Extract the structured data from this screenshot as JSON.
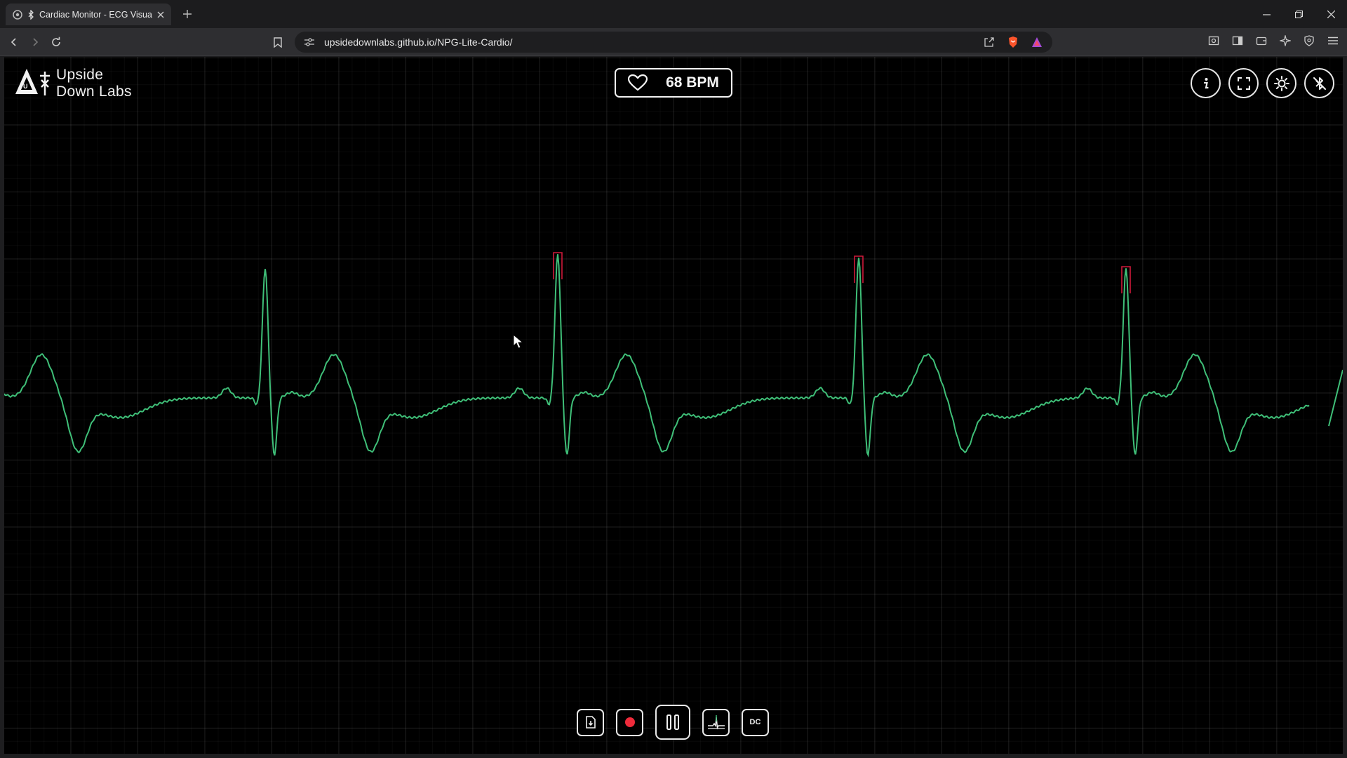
{
  "browser": {
    "tab_title": "Cardiac Monitor - ECG Visuali",
    "url": "upsidedownlabs.github.io/NPG-Lite-Cardio/"
  },
  "app": {
    "logo_line1": "Upside",
    "logo_line2": "Down Labs",
    "heart_rate": "68 BPM",
    "trace_color": "#3fbf78",
    "peak_marker_color": "#d01a3a",
    "bottom_controls": {
      "dc_label": "DC"
    }
  },
  "icons": {
    "top": [
      "info-icon",
      "fullscreen-icon",
      "theme-sun-icon",
      "bluetooth-off-icon"
    ],
    "bottom": [
      "save-file-icon",
      "record-icon",
      "pause-icon",
      "filter-ecg-icon",
      "dc-icon"
    ]
  }
}
